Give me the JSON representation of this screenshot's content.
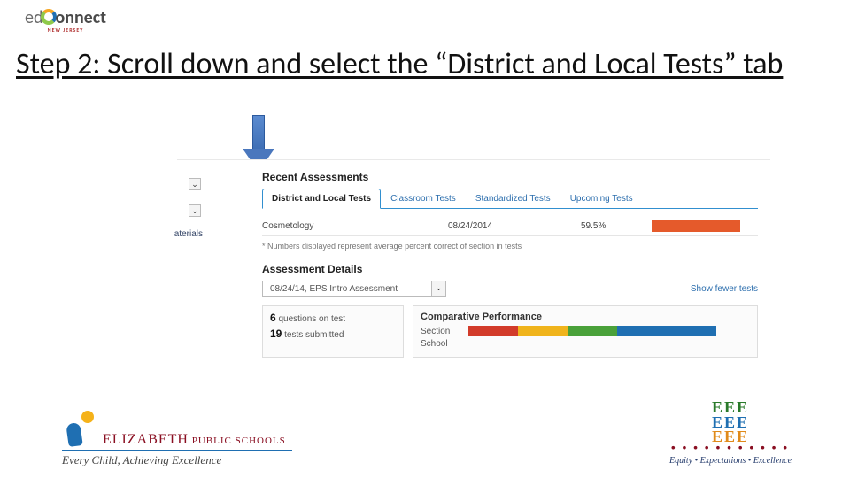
{
  "top_logo": {
    "prefix": "ed",
    "suffix": "onnect",
    "subtitle": "NEW JERSEY"
  },
  "heading": "Step 2: Scroll down and select the “District and Local Tests” tab",
  "panel": {
    "left_aterials": "aterials",
    "recent_title": "Recent Assessments",
    "tabs": [
      {
        "label": "District and Local Tests",
        "active": true
      },
      {
        "label": "Classroom Tests",
        "active": false
      },
      {
        "label": "Standardized Tests",
        "active": false
      },
      {
        "label": "Upcoming Tests",
        "active": false
      }
    ],
    "row": {
      "name": "Cosmetology",
      "date": "08/24/2014",
      "pct": "59.5%"
    },
    "note": "* Numbers displayed represent average percent correct of section in tests",
    "details_title": "Assessment Details",
    "dropdown_value": "08/24/14, EPS Intro Assessment",
    "show_link": "Show fewer tests",
    "q_count": "6",
    "q_label": "questions on test",
    "t_count": "19",
    "t_label": "tests submitted",
    "cp_title": "Comparative Performance",
    "cp_rows": [
      "Section",
      "School"
    ]
  },
  "footer_left": {
    "first": "E",
    "mid": "LIZABETH",
    "small1": " PUBLIC ",
    "small2": "SCHOOLS",
    "tagline": "Every Child, Achieving Excellence"
  },
  "footer_right": {
    "rows": [
      "EEE",
      "EEE",
      "EEE"
    ],
    "tag": "Equity • Expectations • Excellence"
  }
}
